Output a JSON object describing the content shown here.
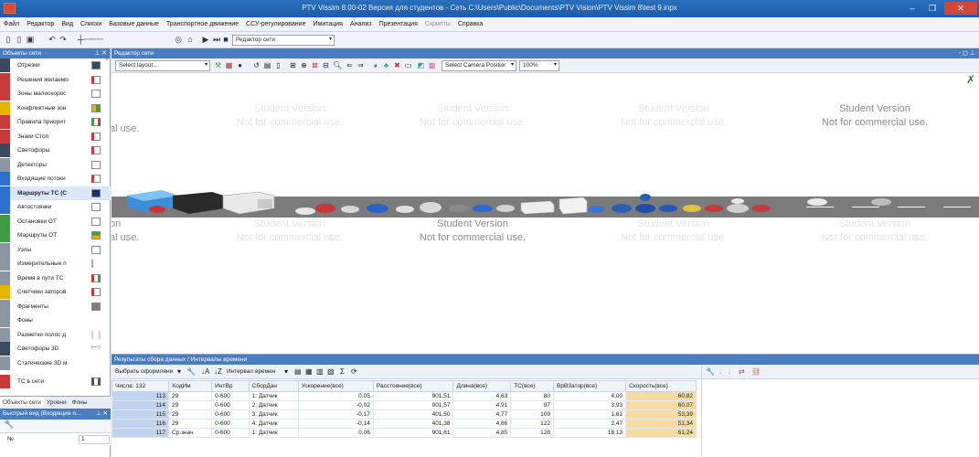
{
  "window": {
    "title": "PTV Vissim 8.00-02 Версия для студентов - Сеть C:\\Users\\Public\\Documents\\PTV Vision\\PTV Vissim 8\\test 9.inpx",
    "minimize": "–",
    "maximize": "❐",
    "close": "✕"
  },
  "menu": {
    "items": [
      "Файл",
      "Редактор",
      "Вид",
      "Списки",
      "Базовые данные",
      "Транспортное движение",
      "ССУ-регулирование",
      "Имитация",
      "Анализ",
      "Презентация",
      "Скрипты",
      "Справка"
    ]
  },
  "toolbar": {
    "mode_select": "Редактор сети",
    "dropdown": "▾"
  },
  "left_panel": {
    "title": "Объекты сети",
    "pin": "⊥ ✕",
    "items": [
      {
        "label": "Отрезки"
      },
      {
        "label": "Решения желаемо"
      },
      {
        "label": "Зоны малоскорос"
      },
      {
        "label": "Конфликтные зон"
      },
      {
        "label": "Правила приорит"
      },
      {
        "label": "Знаки Стоп"
      },
      {
        "label": "Светофоры"
      },
      {
        "label": "Детекторы"
      },
      {
        "label": "Входящие потоки"
      },
      {
        "label": "Маршруты ТС (С"
      },
      {
        "label": "Автостоянки"
      },
      {
        "label": "Остановки ОТ"
      },
      {
        "label": "Маршруты ОТ"
      },
      {
        "label": "Узлы"
      },
      {
        "label": "Измерительные п"
      },
      {
        "label": "Время в пути ТС"
      },
      {
        "label": "Счетчики заторов"
      },
      {
        "label": "Фрагменты"
      },
      {
        "label": "Фоны"
      },
      {
        "label": "Разметки полос д"
      },
      {
        "label": "Светофоры 3D"
      },
      {
        "label": "Статические 3D м"
      },
      {
        "label": "ТС в сети"
      }
    ],
    "tabs": [
      "Объекты сети",
      "Уровни",
      "Фоны"
    ],
    "quick_view_title": "Быстрый вид (Входящие п...",
    "quick_view_close": "⊥ ✕",
    "quick_row_key": "№",
    "quick_row_value": "1"
  },
  "editor": {
    "title": "Редактор сети",
    "controls": "- ◻ ⊥",
    "layout_select": "Select layout...",
    "camera_select": "Select Camera Positior",
    "zoom": "100%",
    "watermark_line1": "Student Version",
    "watermark_line2": "Not for commercial use.",
    "watermark_partial_1": "al use.",
    "watermark_partial_2": "on",
    "watermark_partial_3": "al use."
  },
  "results": {
    "title": "Результаты сбора данных / Интервалы времени",
    "layout_label": "Выбрать оформлени",
    "interval_label": "Интервал времен",
    "columns": [
      "Числа: 132",
      "ХодИм",
      "ИнтВр",
      "СборДан",
      "Ускорение(все)",
      "Расстояние(все)",
      "Длина(все)",
      "ТС(все)",
      "ВрВЗатор(все)",
      "Скорость(все)"
    ],
    "rows": [
      [
        "113",
        "29",
        "0-600",
        "1: Датчик",
        "0,05",
        "901,51",
        "4,63",
        "80",
        "4,00",
        "60,82"
      ],
      [
        "114",
        "29",
        "0-600",
        "2: Датчик",
        "-0,02",
        "901,57",
        "4,91",
        "97",
        "3,93",
        "60,07"
      ],
      [
        "115",
        "29",
        "0-600",
        "3: Датчик",
        "-0,17",
        "401,50",
        "4,77",
        "109",
        "1,61",
        "53,39"
      ],
      [
        "116",
        "29",
        "0-600",
        "4: Датчик",
        "-0,14",
        "401,38",
        "4,86",
        "122",
        "2,47",
        "51,34"
      ],
      [
        "117",
        "Ср.знач",
        "0-600",
        "1: Датчик",
        "0,06",
        "901,61",
        "4,85",
        "128",
        "18,13",
        "61,24"
      ]
    ]
  },
  "colors": {
    "title_bar": "#1d5ca7",
    "panel_header": "#4a7cc0",
    "road": "#7b7b7b",
    "highlight_cell": "#f7dca0"
  },
  "icons": {
    "undo": "↶",
    "redo": "↷",
    "new": "🗋",
    "save": "💾",
    "play": "▶",
    "step": "⏭",
    "stop": "■",
    "sum": "Σ",
    "filter": "⊿"
  }
}
